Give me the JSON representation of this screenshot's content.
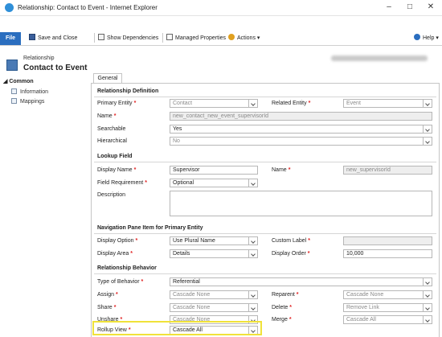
{
  "window": {
    "title": "Relationship: Contact to Event - Internet Explorer"
  },
  "ribbon": {
    "file_label": "File",
    "save_close_label": "Save and Close",
    "show_dependencies_label": "Show Dependencies",
    "managed_properties_label": "Managed Properties",
    "actions_label": "Actions",
    "help_label": "Help"
  },
  "header": {
    "entity_type": "Relationship",
    "entity_name": "Contact to Event"
  },
  "nav": {
    "group_label": "Common",
    "items": [
      {
        "label": "Information"
      },
      {
        "label": "Mappings"
      }
    ]
  },
  "tabs": [
    {
      "label": "General"
    }
  ],
  "form": {
    "relationship_definition": {
      "heading": "Relationship Definition",
      "primary_entity_label": "Primary Entity",
      "primary_entity_value": "Contact",
      "related_entity_label": "Related Entity",
      "related_entity_value": "Event",
      "name_label": "Name",
      "name_value": "new_contact_new_event_supervisorId",
      "searchable_label": "Searchable",
      "searchable_value": "Yes",
      "hierarchical_label": "Hierarchical",
      "hierarchical_value": "No"
    },
    "lookup_field": {
      "heading": "Lookup Field",
      "display_name_label": "Display Name",
      "display_name_value": "Supervisor",
      "name_label": "Name",
      "name_value": "new_supervisorId",
      "field_requirement_label": "Field Requirement",
      "field_requirement_value": "Optional",
      "description_label": "Description",
      "description_value": ""
    },
    "navigation_pane": {
      "heading": "Navigation Pane Item for Primary Entity",
      "display_option_label": "Display Option",
      "display_option_value": "Use Plural Name",
      "custom_label_label": "Custom Label",
      "custom_label_value": "",
      "display_area_label": "Display Area",
      "display_area_value": "Details",
      "display_order_label": "Display Order",
      "display_order_value": "10,000"
    },
    "relationship_behavior": {
      "heading": "Relationship Behavior",
      "type_label": "Type of Behavior",
      "type_value": "Referential",
      "assign_label": "Assign",
      "assign_value": "Cascade None",
      "reparent_label": "Reparent",
      "reparent_value": "Cascade None",
      "share_label": "Share",
      "share_value": "Cascade None",
      "delete_label": "Delete",
      "delete_value": "Remove Link",
      "unshare_label": "Unshare",
      "unshare_value": "Cascade None",
      "merge_label": "Merge",
      "merge_value": "Cascade All",
      "rollup_label": "Rollup View",
      "rollup_value": "Cascade All"
    }
  },
  "colors": {
    "file_button": "#2b6ebf",
    "required_marker": "#e02020",
    "highlight_border": "#f0e23a"
  }
}
